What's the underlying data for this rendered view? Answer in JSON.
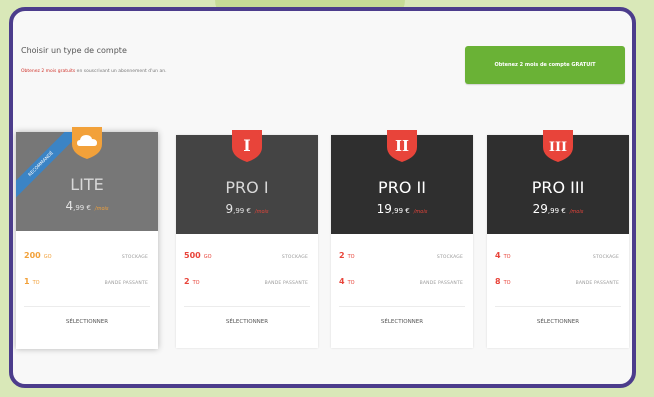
{
  "header": {
    "title": "Choisir un type de compte",
    "subtitle_highlight": "Obtenez 2 mois gratuits",
    "subtitle_rest": " en souscrivant un abonnement d'un an.",
    "free_button_label": "Obtenez 2 mois de compte GRATUIT"
  },
  "colors": {
    "frame": "#4c3d8c",
    "green_button": "#6ab236",
    "lite_accent": "#f2a13a",
    "pro_accent": "#e8443a",
    "ribbon": "#3b84c5"
  },
  "plans": [
    {
      "name": "LITE",
      "price_int": "4",
      "price_dec": ",99 €",
      "price_period": "/mois",
      "ribbon": "RECOMMANDÉ",
      "icon": "cloud-icon",
      "storage_value": "200",
      "storage_unit": "GO",
      "storage_label": "STOCKAGE",
      "bandwidth_value": "1",
      "bandwidth_unit": "TO",
      "bandwidth_label": "BANDE PASSANTE",
      "select_label": "SÉLECTIONNER"
    },
    {
      "name": "PRO I",
      "price_int": "9",
      "price_dec": ",99 €",
      "price_period": "/mois",
      "badge_text": "I",
      "storage_value": "500",
      "storage_unit": "GO",
      "storage_label": "STOCKAGE",
      "bandwidth_value": "2",
      "bandwidth_unit": "TO",
      "bandwidth_label": "BANDE PASSANTE",
      "select_label": "SÉLECTIONNER"
    },
    {
      "name": "PRO II",
      "price_int": "19",
      "price_dec": ",99 €",
      "price_period": "/mois",
      "badge_text": "II",
      "storage_value": "2",
      "storage_unit": "TO",
      "storage_label": "STOCKAGE",
      "bandwidth_value": "4",
      "bandwidth_unit": "TO",
      "bandwidth_label": "BANDE PASSANTE",
      "select_label": "SÉLECTIONNER"
    },
    {
      "name": "PRO III",
      "price_int": "29",
      "price_dec": ",99 €",
      "price_period": "/mois",
      "badge_text": "III",
      "storage_value": "4",
      "storage_unit": "TO",
      "storage_label": "STOCKAGE",
      "bandwidth_value": "8",
      "bandwidth_unit": "TO",
      "bandwidth_label": "BANDE PASSANTE",
      "select_label": "SÉLECTIONNER"
    }
  ]
}
